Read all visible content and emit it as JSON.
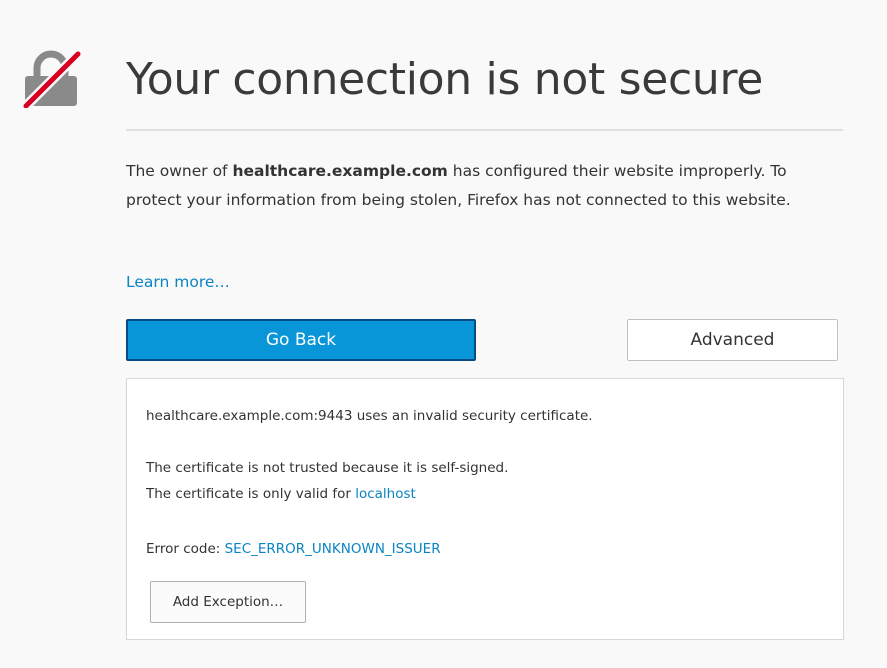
{
  "header": {
    "title": "Your connection is not secure",
    "icon": "broken-lock-icon",
    "accent_color": "#d70022"
  },
  "description": {
    "part1": "The owner of ",
    "domain": "healthcare.example.com",
    "part2": " has configured their website improperly. To protect your information from being stolen, Firefox has not connected to this website."
  },
  "learn_more_label": "Learn more…",
  "buttons": {
    "go_back_label": "Go Back",
    "advanced_label": "Advanced",
    "primary_color": "#0996d8"
  },
  "advanced_panel": {
    "line1": "healthcare.example.com:9443 uses an invalid security certificate.",
    "line2": "The certificate is not trusted because it is self-signed.",
    "line3_prefix": "The certificate is only valid for ",
    "line3_link": "localhost",
    "error_prefix": "Error code: ",
    "error_code": "SEC_ERROR_UNKNOWN_ISSUER",
    "add_exception_label": "Add Exception…"
  }
}
